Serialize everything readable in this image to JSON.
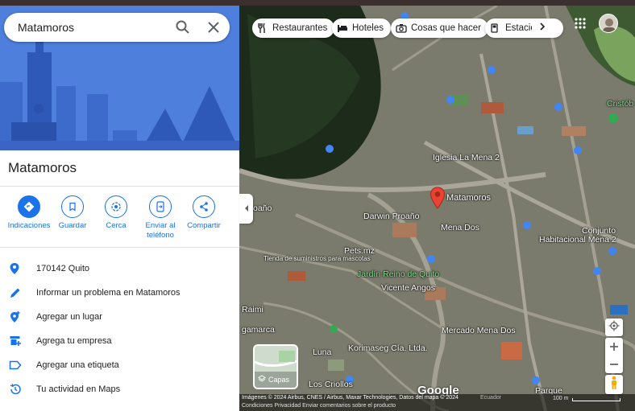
{
  "search": {
    "query": "Matamoros"
  },
  "place": {
    "title": "Matamoros"
  },
  "actions": [
    {
      "label": "Indicaciones",
      "icon": "directions-icon"
    },
    {
      "label": "Guardar",
      "icon": "bookmark-icon"
    },
    {
      "label": "Cerca",
      "icon": "nearby-icon"
    },
    {
      "label": "Enviar al teléfono",
      "icon": "send-to-phone-icon"
    },
    {
      "label": "Compartir",
      "icon": "share-icon"
    }
  ],
  "info_rows": [
    {
      "text": "170142 Quito",
      "icon": "location-pin-icon"
    },
    {
      "text": "Informar un problema en Matamoros",
      "icon": "pencil-icon"
    },
    {
      "text": "Agregar un lugar",
      "icon": "add-place-icon"
    },
    {
      "text": "Agrega tu empresa",
      "icon": "store-icon"
    },
    {
      "text": "Agregar una etiqueta",
      "icon": "label-icon"
    },
    {
      "text": "Tu actividad en Maps",
      "icon": "history-icon"
    }
  ],
  "chips": [
    {
      "label": "Restaurantes",
      "icon": "restaurant-icon"
    },
    {
      "label": "Hoteles",
      "icon": "hotel-icon"
    },
    {
      "label": "Cosas que hacer",
      "icon": "camera-icon"
    },
    {
      "label": "Estacion",
      "icon": "gas-station-icon"
    }
  ],
  "map_labels": {
    "iglesia": "Iglesia La Mena 2",
    "matamoros": "Matamoros",
    "mena_dos": "Mena Dos",
    "habitacional": "Habitacional Mena 2",
    "conjunto": "Conjunto",
    "jardin": "Jardín Reino de Quito",
    "pets": "Pets.mz",
    "tienda": "Tienda de suministros para mascotas",
    "darwin": "Darwin Proaño",
    "vicente": "Vicente Angos",
    "mercado": "Mercado Mena Dos",
    "korima": "Korimaseg Cía. Ltda.",
    "criollos": "Los Criollos",
    "cristob": "Cristób",
    "raimi": "Raimi",
    "gamarca": "gamarca",
    "luna": "Luna",
    "oano": "oaño",
    "parque": "Parque"
  },
  "map": {
    "layers_label": "Capas",
    "logo": "Google",
    "attribution": "Imágenes © 2024 Airbus, CNES / Airbus, Maxar Technologies, Datos del mapa © 2024",
    "country": "Ecuador",
    "links": "Condiciones     Privacidad     Enviar comentarios sobre el producto",
    "scale": "100 m"
  },
  "colors": {
    "accent": "#1a73e8",
    "hero": "#4e7fdc",
    "pin": "#ea4335"
  }
}
